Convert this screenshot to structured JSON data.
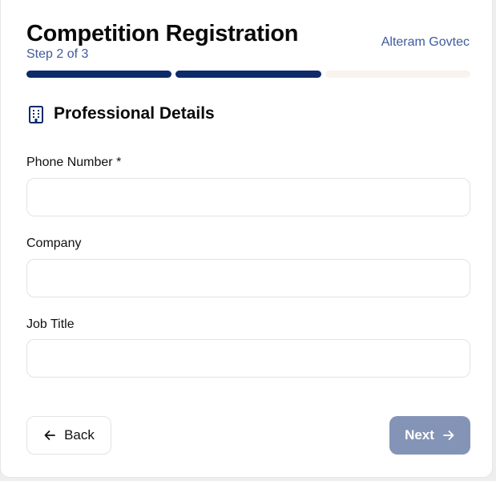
{
  "header": {
    "title": "Competition Registration",
    "step_text": "Step 2 of 3",
    "brand": "Alteram Govtec"
  },
  "progress": {
    "total_steps": 3,
    "completed_steps": 2,
    "active_color": "#0d2a6b",
    "inactive_color": "#f8f3ef"
  },
  "section": {
    "icon": "building-icon",
    "title": "Professional Details"
  },
  "form": {
    "phone": {
      "label": "Phone Number *",
      "value": "",
      "placeholder": ""
    },
    "company": {
      "label": "Company",
      "value": "",
      "placeholder": ""
    },
    "job_title": {
      "label": "Job Title",
      "value": "",
      "placeholder": ""
    }
  },
  "actions": {
    "back_label": "Back",
    "back_icon": "arrow-left-icon",
    "next_label": "Next",
    "next_icon": "arrow-right-icon",
    "next_color": "#8494b6"
  }
}
